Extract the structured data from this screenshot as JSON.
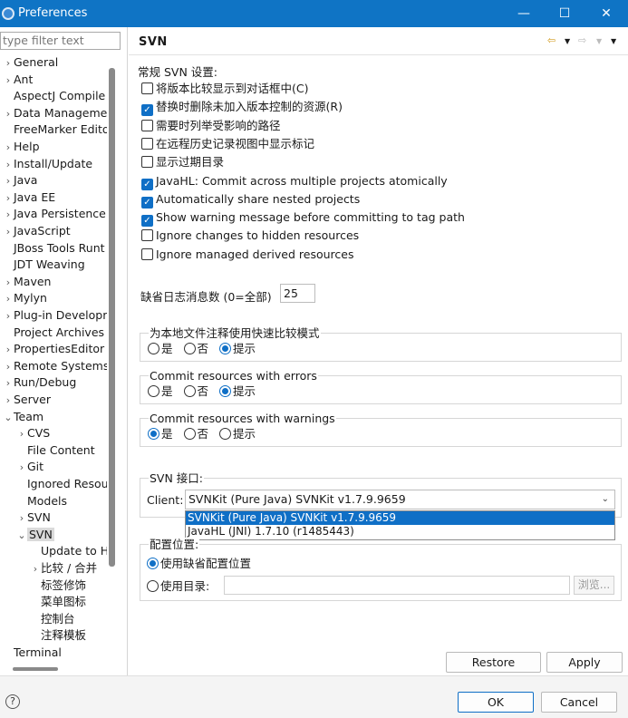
{
  "window": {
    "title": "Preferences",
    "minimize_glyph": "—",
    "maximize_glyph": "☐",
    "close_glyph": "✕"
  },
  "filter": {
    "placeholder": "type filter text"
  },
  "tree": [
    {
      "label": "General",
      "twisty": "›",
      "indent": 0
    },
    {
      "label": "Ant",
      "twisty": "›",
      "indent": 0
    },
    {
      "label": "AspectJ Compile",
      "twisty": "",
      "indent": 0
    },
    {
      "label": "Data Manageme",
      "twisty": "›",
      "indent": 0
    },
    {
      "label": "FreeMarker Edito",
      "twisty": "",
      "indent": 0
    },
    {
      "label": "Help",
      "twisty": "›",
      "indent": 0
    },
    {
      "label": "Install/Update",
      "twisty": "›",
      "indent": 0
    },
    {
      "label": "Java",
      "twisty": "›",
      "indent": 0
    },
    {
      "label": "Java EE",
      "twisty": "›",
      "indent": 0
    },
    {
      "label": "Java Persistence",
      "twisty": "›",
      "indent": 0
    },
    {
      "label": "JavaScript",
      "twisty": "›",
      "indent": 0
    },
    {
      "label": "JBoss Tools Runt",
      "twisty": "",
      "indent": 0
    },
    {
      "label": "JDT Weaving",
      "twisty": "",
      "indent": 0
    },
    {
      "label": "Maven",
      "twisty": "›",
      "indent": 0
    },
    {
      "label": "Mylyn",
      "twisty": "›",
      "indent": 0
    },
    {
      "label": "Plug-in Developr",
      "twisty": "›",
      "indent": 0
    },
    {
      "label": "Project Archives",
      "twisty": "",
      "indent": 0
    },
    {
      "label": "PropertiesEditor",
      "twisty": "›",
      "indent": 0
    },
    {
      "label": "Remote Systems",
      "twisty": "›",
      "indent": 0
    },
    {
      "label": "Run/Debug",
      "twisty": "›",
      "indent": 0
    },
    {
      "label": "Server",
      "twisty": "›",
      "indent": 0
    },
    {
      "label": "Team",
      "twisty": "⌄",
      "indent": 0
    },
    {
      "label": "CVS",
      "twisty": "›",
      "indent": 1
    },
    {
      "label": "File Content",
      "twisty": "",
      "indent": 1
    },
    {
      "label": "Git",
      "twisty": "›",
      "indent": 1
    },
    {
      "label": "Ignored Resou",
      "twisty": "",
      "indent": 1
    },
    {
      "label": "Models",
      "twisty": "",
      "indent": 1
    },
    {
      "label": "SVN",
      "twisty": "›",
      "indent": 1
    },
    {
      "label": "SVN",
      "twisty": "⌄",
      "indent": 1,
      "selected": true
    },
    {
      "label": "Update to H",
      "twisty": "",
      "indent": 2
    },
    {
      "label": "比较 / 合并",
      "twisty": "›",
      "indent": 2
    },
    {
      "label": "标签修饰",
      "twisty": "",
      "indent": 2
    },
    {
      "label": "菜单图标",
      "twisty": "",
      "indent": 2
    },
    {
      "label": "控制台",
      "twisty": "",
      "indent": 2
    },
    {
      "label": "注释模板",
      "twisty": "",
      "indent": 2
    },
    {
      "label": "Terminal",
      "twisty": "",
      "indent": 0
    }
  ],
  "page": {
    "title": "SVN",
    "general_label": "常规 SVN 设置:",
    "checkboxes": [
      {
        "label": "将版本比较显示到对话框中(C)",
        "checked": false
      },
      {
        "label": "替换时删除未加入版本控制的资源(R)",
        "checked": true
      },
      {
        "label": "需要时列举受影响的路径",
        "checked": false
      },
      {
        "label": "在远程历史记录视图中显示标记",
        "checked": false
      },
      {
        "label": "显示过期目录",
        "checked": false
      },
      {
        "label": "JavaHL: Commit across multiple projects atomically",
        "checked": true
      },
      {
        "label": "Automatically share nested projects",
        "checked": true
      },
      {
        "label": "Show warning message before committing to tag path",
        "checked": true
      },
      {
        "label": "Ignore changes to hidden resources",
        "checked": false
      },
      {
        "label": "Ignore managed derived resources",
        "checked": false
      }
    ],
    "log_count_label": "缺省日志消息数 (0=全部)",
    "log_count_value": "25",
    "groups": [
      {
        "title": "为本地文件注释使用快速比较模式",
        "options": [
          "是",
          "否",
          "提示"
        ],
        "selected": 2
      },
      {
        "title": "Commit resources with errors",
        "options": [
          "是",
          "否",
          "提示"
        ],
        "selected": 2
      },
      {
        "title": "Commit resources with warnings",
        "options": [
          "是",
          "否",
          "提示"
        ],
        "selected": 0
      }
    ],
    "svn_interface": {
      "title": "SVN 接口:",
      "client_label": "Client:",
      "client_value": "SVNKit (Pure Java) SVNKit v1.7.9.9659",
      "options": [
        "SVNKit (Pure Java) SVNKit v1.7.9.9659",
        "JavaHL (JNI) 1.7.10 (r1485443)"
      ],
      "selected_index": 0
    },
    "config": {
      "title": "配置位置:",
      "default_label": "使用缺省配置位置",
      "custom_label": "使用目录:",
      "browse_label": "浏览...",
      "selected": 0
    },
    "restore_defaults_label": "Restore Defaults",
    "apply_label": "Apply"
  },
  "footer": {
    "ok_label": "OK",
    "cancel_label": "Cancel",
    "help_glyph": "?"
  },
  "colors": {
    "title_bar": "#0f74c5",
    "accent": "#0f6fc6"
  }
}
